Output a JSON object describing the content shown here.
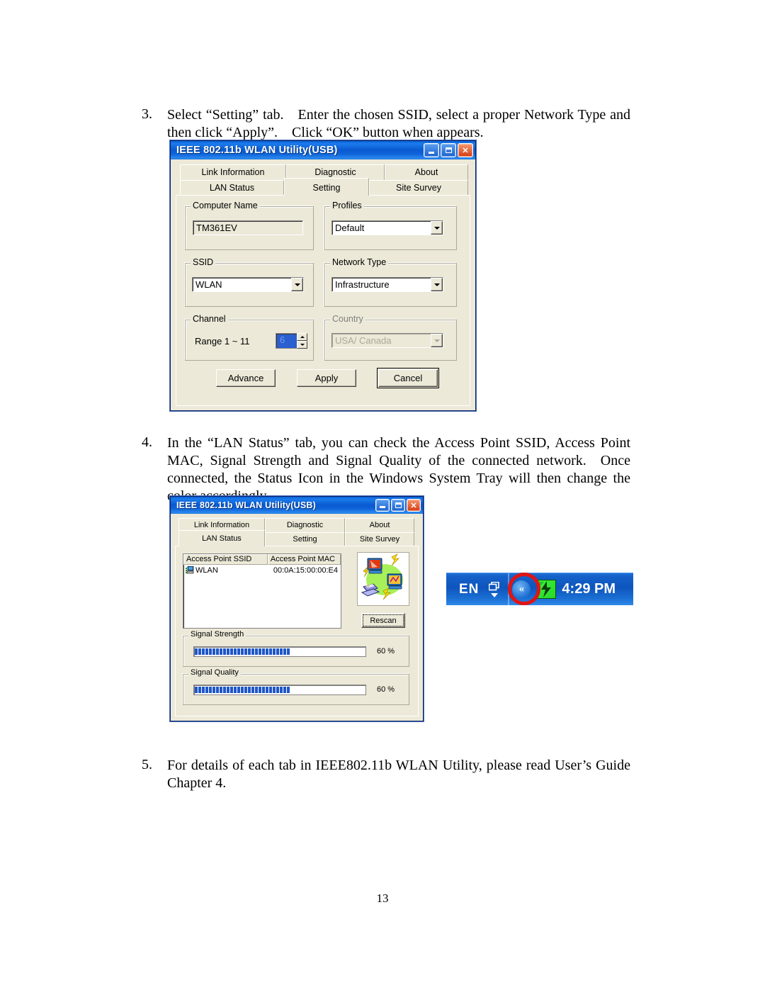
{
  "document": {
    "page_number": "13",
    "steps": [
      {
        "number": "3.",
        "text": "Select “Setting” tab. Enter the chosen SSID, select a proper Network Type and then click “Apply”. Click “OK” button when appears."
      },
      {
        "number": "4.",
        "text": "In the “LAN Status” tab, you can check the Access Point SSID, Access Point MAC, Signal Strength and Signal Quality of the connected network. Once connected, the Status Icon in the Windows System Tray will then change the color accordingly."
      },
      {
        "number": "5.",
        "text": "For details of each tab in IEEE802.11b WLAN Utility, please read User’s Guide Chapter 4."
      }
    ]
  },
  "setting_dialog": {
    "title": "IEEE 802.11b WLAN Utility(USB)",
    "window_buttons": {
      "minimize": "minimize-icon",
      "maximize": "maximize-icon",
      "close": "✕"
    },
    "tabs_row1": [
      "Link Information",
      "Diagnostic",
      "About"
    ],
    "tabs_row2": [
      "LAN Status",
      "Setting",
      "Site Survey"
    ],
    "selected_tab": "Setting",
    "groups": {
      "computer_name": {
        "legend": "Computer Name",
        "value": "TM361EV"
      },
      "profiles": {
        "legend": "Profiles",
        "value": "Default"
      },
      "ssid": {
        "legend": "SSID",
        "value": "WLAN"
      },
      "network_type": {
        "legend": "Network Type",
        "value": "Infrastructure"
      },
      "channel": {
        "legend": "Channel",
        "range_label": "Range 1 ~ 11",
        "value": "6"
      },
      "country": {
        "legend": "Country",
        "value": "USA/ Canada",
        "disabled": true
      }
    },
    "buttons": {
      "advance": "Advance",
      "apply": "Apply",
      "cancel": "Cancel"
    }
  },
  "lan_status_dialog": {
    "title": "IEEE 802.11b WLAN Utility(USB)",
    "tabs_row1": [
      "Link Information",
      "Diagnostic",
      "About"
    ],
    "tabs_row2": [
      "LAN Status",
      "Setting",
      "Site Survey"
    ],
    "selected_tab": "LAN Status",
    "list": {
      "columns": [
        "Access Point SSID",
        "Access Point MAC"
      ],
      "rows": [
        {
          "ssid": "WLAN",
          "mac": "00:0A:15:00:00:E4",
          "icon": "access-point-icon"
        }
      ]
    },
    "network_image": "network-computers-illustration",
    "rescan_button": "Rescan",
    "signal_strength": {
      "legend": "Signal Strength",
      "value": "60 %",
      "percent": 60
    },
    "signal_quality": {
      "legend": "Signal Quality",
      "value": "60 %",
      "percent": 60
    }
  },
  "system_tray": {
    "language_indicator": "EN",
    "windows_glyph": "❐",
    "chevron": "«",
    "status_icon": "wlan-status-icon-green",
    "clock": "4:29 PM",
    "highlight_color": "#e01414"
  }
}
